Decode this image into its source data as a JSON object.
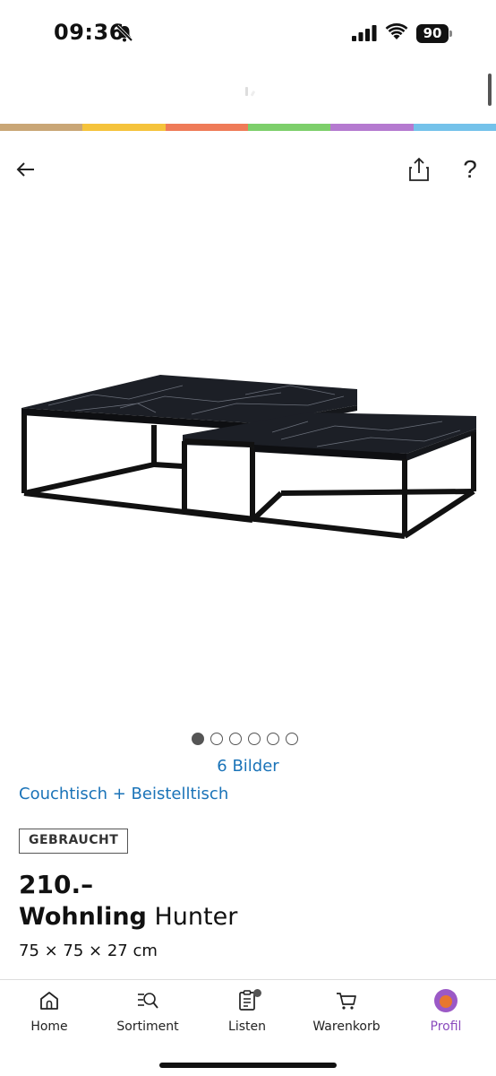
{
  "status_bar": {
    "time": "09:36",
    "battery": "90"
  },
  "header": {
    "stripe_colors": [
      "#c9a676",
      "#f5c33b",
      "#ef7b58",
      "#7dcf6b",
      "#b57ad0",
      "#74c2ea"
    ]
  },
  "nav": {
    "back_icon": "arrow-left-icon",
    "share_icon": "share-icon",
    "help_label": "?"
  },
  "gallery": {
    "total_images": 6,
    "active_index": 0,
    "image_count_label": "6 Bilder"
  },
  "product": {
    "category": "Couchtisch + Beistelltisch",
    "condition": "GEBRAUCHT",
    "price": "210.–",
    "brand": "Wohnling",
    "name": "Hunter",
    "dimensions": "75 × 75 × 27 cm"
  },
  "bottom_nav": {
    "items": [
      {
        "label": "Home",
        "icon": "home-icon"
      },
      {
        "label": "Sortiment",
        "icon": "sortiment-search-icon"
      },
      {
        "label": "Listen",
        "icon": "list-icon"
      },
      {
        "label": "Warenkorb",
        "icon": "cart-icon"
      },
      {
        "label": "Profil",
        "icon": "avatar"
      }
    ],
    "active": "Profil",
    "active_color": "#8a4bbd"
  },
  "colors": {
    "link": "#1a73b8"
  }
}
